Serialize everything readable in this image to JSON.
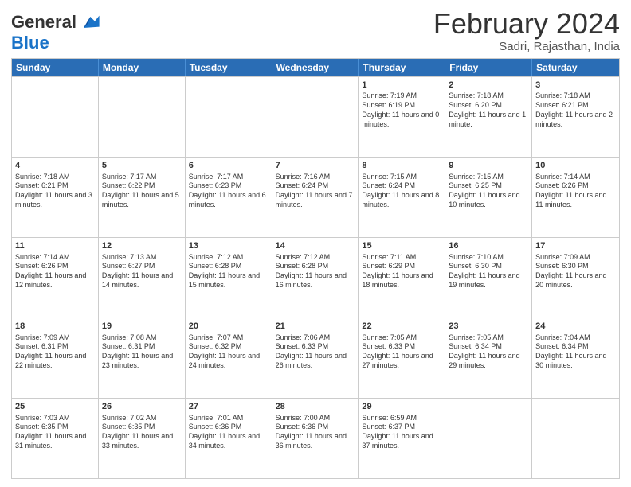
{
  "logo": {
    "line1": "General",
    "line2": "Blue"
  },
  "title": "February 2024",
  "subtitle": "Sadri, Rajasthan, India",
  "days_of_week": [
    "Sunday",
    "Monday",
    "Tuesday",
    "Wednesday",
    "Thursday",
    "Friday",
    "Saturday"
  ],
  "weeks": [
    [
      {
        "day": "",
        "info": ""
      },
      {
        "day": "",
        "info": ""
      },
      {
        "day": "",
        "info": ""
      },
      {
        "day": "",
        "info": ""
      },
      {
        "day": "1",
        "info": "Sunrise: 7:19 AM\nSunset: 6:19 PM\nDaylight: 11 hours and 0 minutes."
      },
      {
        "day": "2",
        "info": "Sunrise: 7:18 AM\nSunset: 6:20 PM\nDaylight: 11 hours and 1 minute."
      },
      {
        "day": "3",
        "info": "Sunrise: 7:18 AM\nSunset: 6:21 PM\nDaylight: 11 hours and 2 minutes."
      }
    ],
    [
      {
        "day": "4",
        "info": "Sunrise: 7:18 AM\nSunset: 6:21 PM\nDaylight: 11 hours and 3 minutes."
      },
      {
        "day": "5",
        "info": "Sunrise: 7:17 AM\nSunset: 6:22 PM\nDaylight: 11 hours and 5 minutes."
      },
      {
        "day": "6",
        "info": "Sunrise: 7:17 AM\nSunset: 6:23 PM\nDaylight: 11 hours and 6 minutes."
      },
      {
        "day": "7",
        "info": "Sunrise: 7:16 AM\nSunset: 6:24 PM\nDaylight: 11 hours and 7 minutes."
      },
      {
        "day": "8",
        "info": "Sunrise: 7:15 AM\nSunset: 6:24 PM\nDaylight: 11 hours and 8 minutes."
      },
      {
        "day": "9",
        "info": "Sunrise: 7:15 AM\nSunset: 6:25 PM\nDaylight: 11 hours and 10 minutes."
      },
      {
        "day": "10",
        "info": "Sunrise: 7:14 AM\nSunset: 6:26 PM\nDaylight: 11 hours and 11 minutes."
      }
    ],
    [
      {
        "day": "11",
        "info": "Sunrise: 7:14 AM\nSunset: 6:26 PM\nDaylight: 11 hours and 12 minutes."
      },
      {
        "day": "12",
        "info": "Sunrise: 7:13 AM\nSunset: 6:27 PM\nDaylight: 11 hours and 14 minutes."
      },
      {
        "day": "13",
        "info": "Sunrise: 7:12 AM\nSunset: 6:28 PM\nDaylight: 11 hours and 15 minutes."
      },
      {
        "day": "14",
        "info": "Sunrise: 7:12 AM\nSunset: 6:28 PM\nDaylight: 11 hours and 16 minutes."
      },
      {
        "day": "15",
        "info": "Sunrise: 7:11 AM\nSunset: 6:29 PM\nDaylight: 11 hours and 18 minutes."
      },
      {
        "day": "16",
        "info": "Sunrise: 7:10 AM\nSunset: 6:30 PM\nDaylight: 11 hours and 19 minutes."
      },
      {
        "day": "17",
        "info": "Sunrise: 7:09 AM\nSunset: 6:30 PM\nDaylight: 11 hours and 20 minutes."
      }
    ],
    [
      {
        "day": "18",
        "info": "Sunrise: 7:09 AM\nSunset: 6:31 PM\nDaylight: 11 hours and 22 minutes."
      },
      {
        "day": "19",
        "info": "Sunrise: 7:08 AM\nSunset: 6:31 PM\nDaylight: 11 hours and 23 minutes."
      },
      {
        "day": "20",
        "info": "Sunrise: 7:07 AM\nSunset: 6:32 PM\nDaylight: 11 hours and 24 minutes."
      },
      {
        "day": "21",
        "info": "Sunrise: 7:06 AM\nSunset: 6:33 PM\nDaylight: 11 hours and 26 minutes."
      },
      {
        "day": "22",
        "info": "Sunrise: 7:05 AM\nSunset: 6:33 PM\nDaylight: 11 hours and 27 minutes."
      },
      {
        "day": "23",
        "info": "Sunrise: 7:05 AM\nSunset: 6:34 PM\nDaylight: 11 hours and 29 minutes."
      },
      {
        "day": "24",
        "info": "Sunrise: 7:04 AM\nSunset: 6:34 PM\nDaylight: 11 hours and 30 minutes."
      }
    ],
    [
      {
        "day": "25",
        "info": "Sunrise: 7:03 AM\nSunset: 6:35 PM\nDaylight: 11 hours and 31 minutes."
      },
      {
        "day": "26",
        "info": "Sunrise: 7:02 AM\nSunset: 6:35 PM\nDaylight: 11 hours and 33 minutes."
      },
      {
        "day": "27",
        "info": "Sunrise: 7:01 AM\nSunset: 6:36 PM\nDaylight: 11 hours and 34 minutes."
      },
      {
        "day": "28",
        "info": "Sunrise: 7:00 AM\nSunset: 6:36 PM\nDaylight: 11 hours and 36 minutes."
      },
      {
        "day": "29",
        "info": "Sunrise: 6:59 AM\nSunset: 6:37 PM\nDaylight: 11 hours and 37 minutes."
      },
      {
        "day": "",
        "info": ""
      },
      {
        "day": "",
        "info": ""
      }
    ]
  ]
}
